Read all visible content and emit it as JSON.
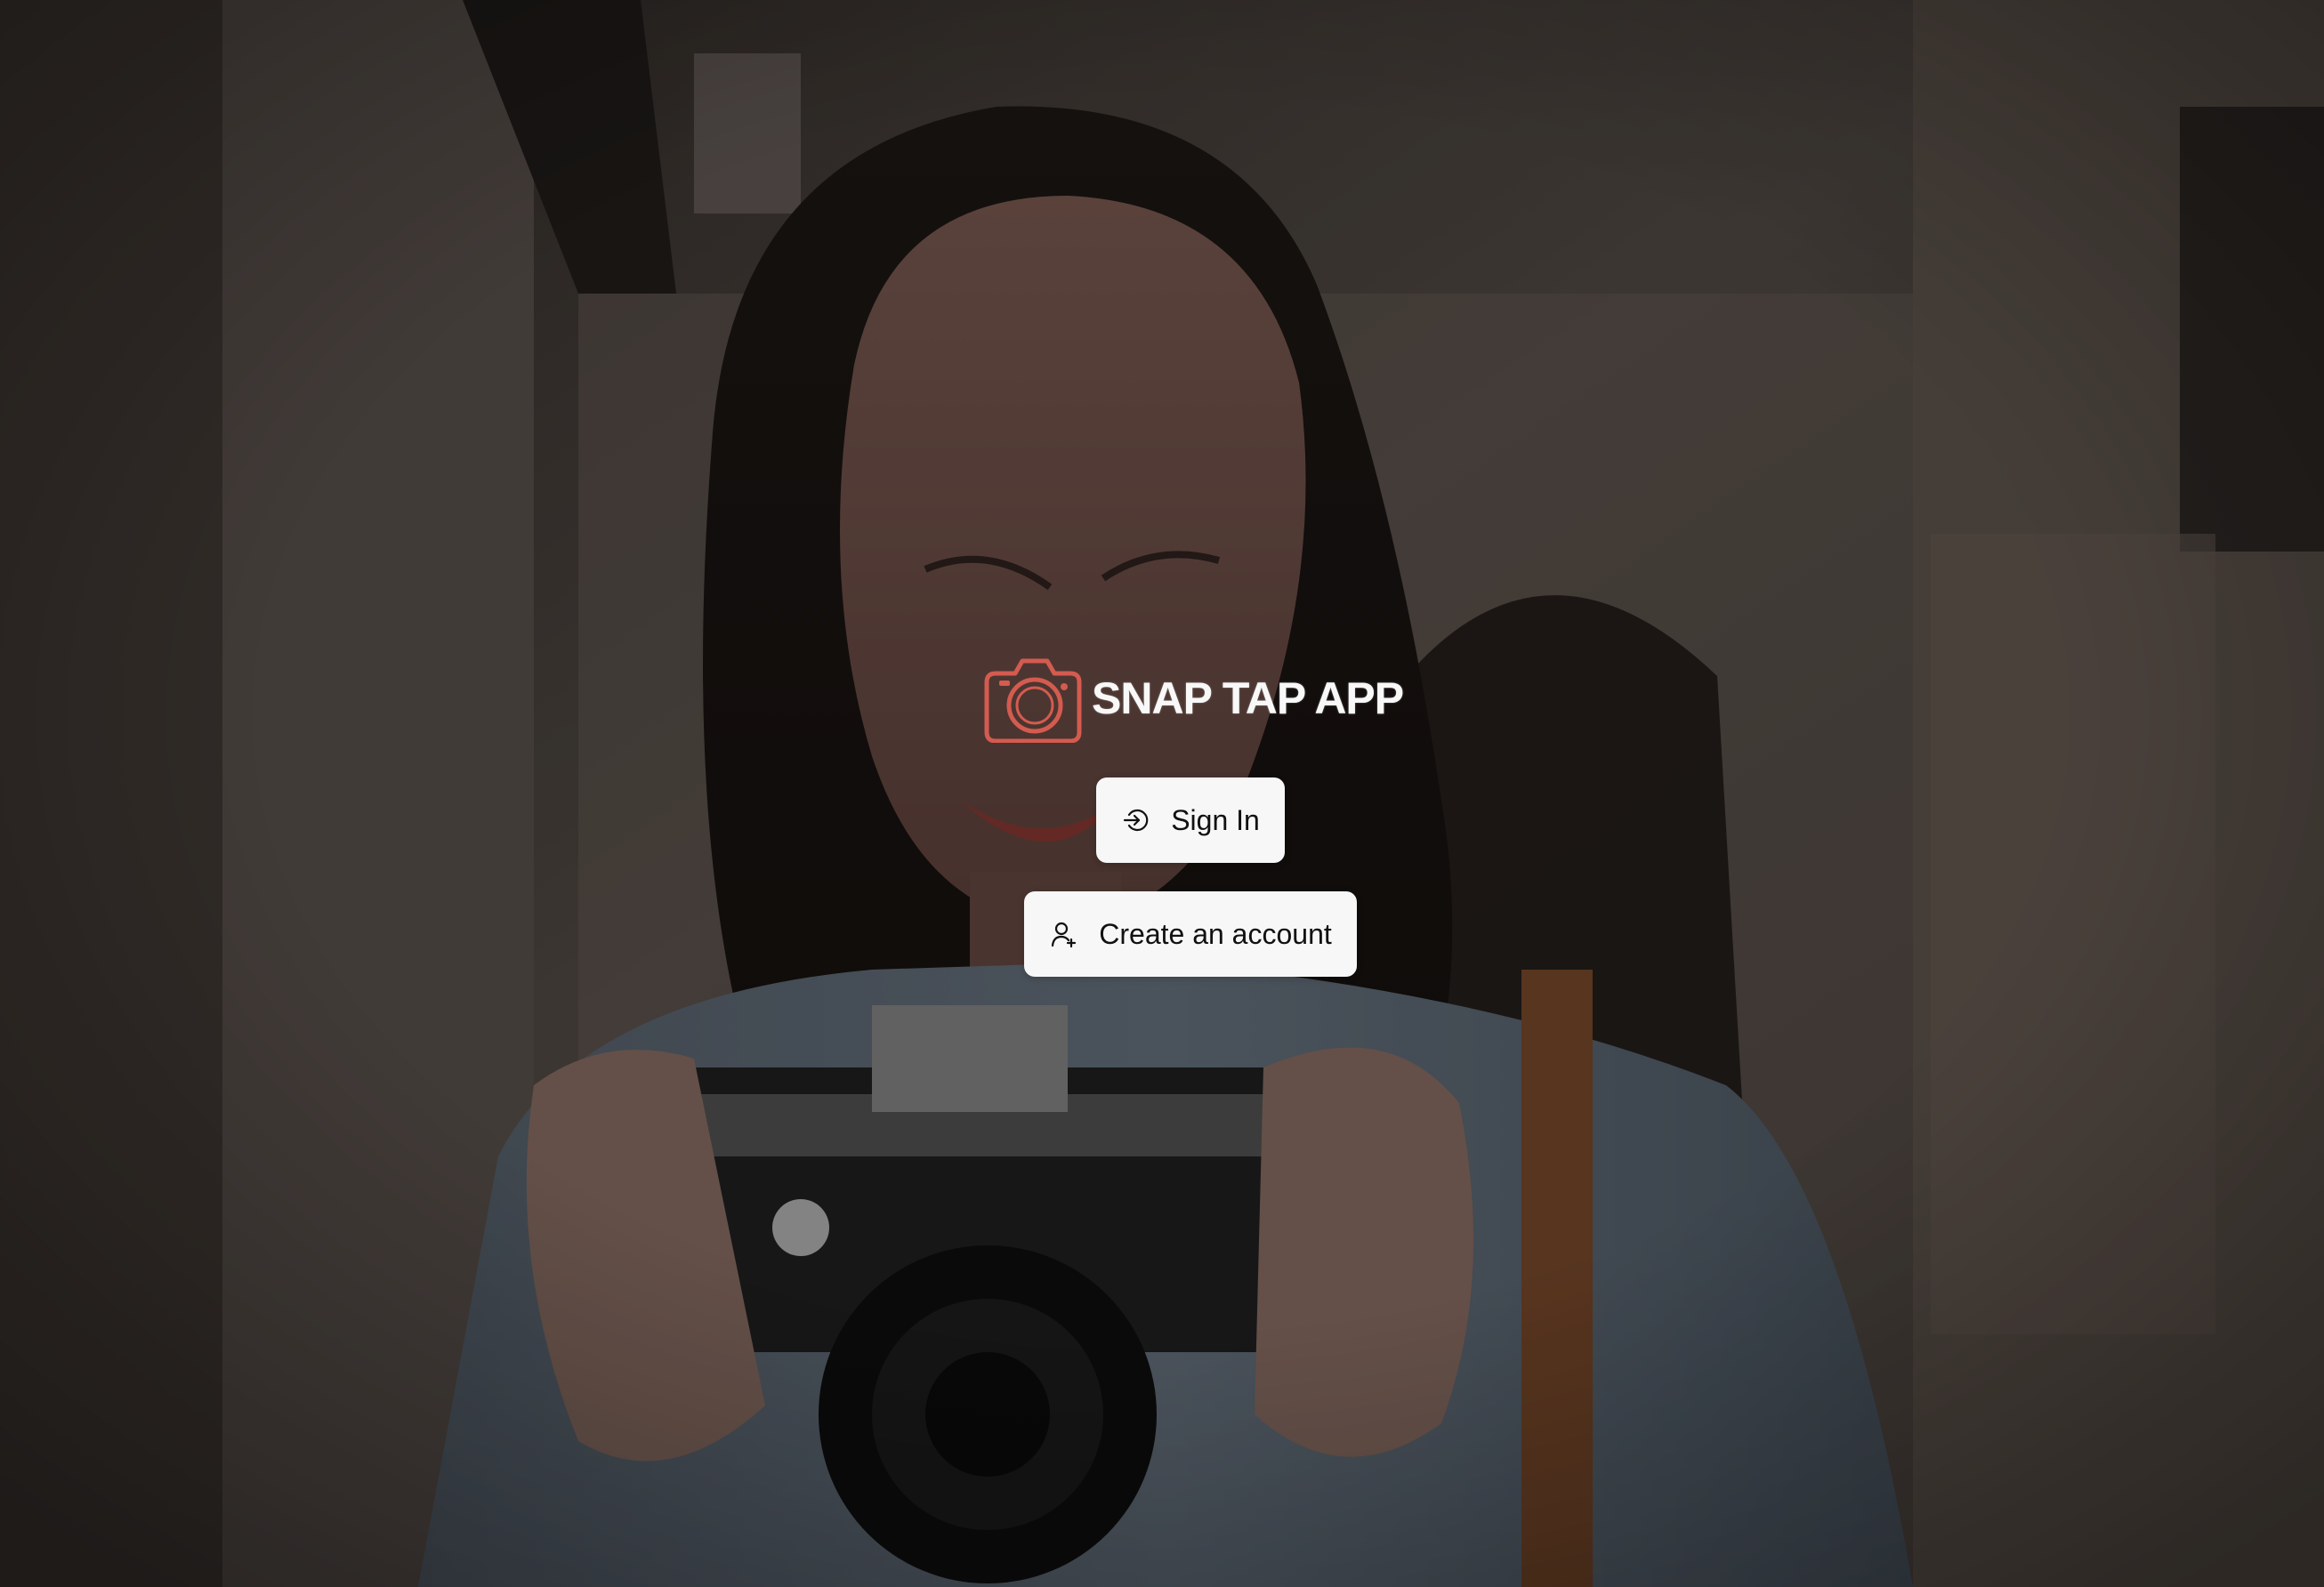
{
  "brand": {
    "name": "SNAP TAP APP",
    "accent": "#d45b4f"
  },
  "actions": {
    "sign_in_label": "Sign In",
    "create_account_label": "Create an account"
  },
  "icons": {
    "logo": "camera-icon",
    "sign_in": "sign-in-icon",
    "create_account": "user-add-icon"
  }
}
